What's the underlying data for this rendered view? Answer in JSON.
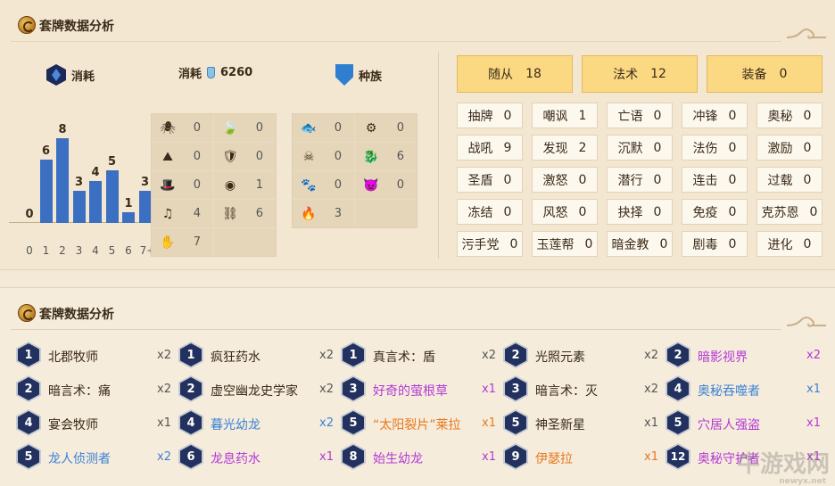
{
  "section1": {
    "title": "套牌数据分析"
  },
  "section2": {
    "title": "套牌数据分析"
  },
  "curve_header": {
    "label": "消耗"
  },
  "total_cost": {
    "label": "消耗",
    "value": "6260"
  },
  "race_header": {
    "label": "种族"
  },
  "chart_data": {
    "type": "bar",
    "title": "",
    "categories": [
      "0",
      "1",
      "2",
      "3",
      "4",
      "5",
      "6",
      "7+"
    ],
    "values": [
      0,
      6,
      8,
      3,
      4,
      5,
      1,
      3
    ],
    "xlabel": "",
    "ylabel": "",
    "ylim": [
      0,
      8
    ],
    "color": "#3b6fc1"
  },
  "class_grid": [
    {
      "icon": "spider-icon",
      "glyph": "🕷",
      "value": "0"
    },
    {
      "icon": "leaf-icon",
      "glyph": "🍃",
      "value": "0"
    },
    {
      "icon": "mountain-icon",
      "glyph": "⛰",
      "value": "0"
    },
    {
      "icon": "shield-icon",
      "glyph": "🛡",
      "value": "0"
    },
    {
      "icon": "hat-icon",
      "glyph": "🎩",
      "value": "0"
    },
    {
      "icon": "eye-icon",
      "glyph": "◉",
      "value": "1"
    },
    {
      "icon": "music-note-icon",
      "glyph": "♫",
      "value": "4"
    },
    {
      "icon": "chain-icon",
      "glyph": "⛓",
      "value": "6"
    },
    {
      "icon": "claw-icon",
      "glyph": "✋",
      "value": "7"
    },
    {
      "icon": "empty",
      "glyph": "",
      "value": ""
    }
  ],
  "race_grid": [
    {
      "icon": "murloc-icon",
      "glyph": "🐟",
      "value": "0"
    },
    {
      "icon": "gear-icon",
      "glyph": "⚙",
      "value": "0"
    },
    {
      "icon": "pirate-icon",
      "glyph": "☠",
      "value": "0"
    },
    {
      "icon": "dragon-icon",
      "glyph": "🐉",
      "value": "6"
    },
    {
      "icon": "paw-icon",
      "glyph": "🐾",
      "value": "0"
    },
    {
      "icon": "demon-icon",
      "glyph": "👿",
      "value": "0"
    },
    {
      "icon": "elemental-icon",
      "glyph": "🔥",
      "value": "3"
    },
    {
      "icon": "empty",
      "glyph": "",
      "value": ""
    }
  ],
  "type_buttons": [
    {
      "label": "随从",
      "value": "18"
    },
    {
      "label": "法术",
      "value": "12"
    },
    {
      "label": "装备",
      "value": "0"
    }
  ],
  "keywords": [
    {
      "label": "抽牌",
      "value": "0"
    },
    {
      "label": "嘲讽",
      "value": "1"
    },
    {
      "label": "亡语",
      "value": "0"
    },
    {
      "label": "冲锋",
      "value": "0"
    },
    {
      "label": "奥秘",
      "value": "0"
    },
    {
      "label": "战吼",
      "value": "9"
    },
    {
      "label": "发现",
      "value": "2"
    },
    {
      "label": "沉默",
      "value": "0"
    },
    {
      "label": "法伤",
      "value": "0"
    },
    {
      "label": "激励",
      "value": "0"
    },
    {
      "label": "圣盾",
      "value": "0"
    },
    {
      "label": "激怒",
      "value": "0"
    },
    {
      "label": "潜行",
      "value": "0"
    },
    {
      "label": "连击",
      "value": "0"
    },
    {
      "label": "过载",
      "value": "0"
    },
    {
      "label": "冻结",
      "value": "0"
    },
    {
      "label": "风怒",
      "value": "0"
    },
    {
      "label": "抉择",
      "value": "0"
    },
    {
      "label": "免疫",
      "value": "0"
    },
    {
      "label": "克苏恩",
      "value": "0"
    },
    {
      "label": "污手党",
      "value": "0"
    },
    {
      "label": "玉莲帮",
      "value": "0"
    },
    {
      "label": "暗金教",
      "value": "0"
    },
    {
      "label": "剧毒",
      "value": "0"
    },
    {
      "label": "进化",
      "value": "0"
    }
  ],
  "rarity_colors": {
    "common": "#3a2a18",
    "rare": "#3b82d6",
    "epic": "#b23ad6",
    "legendary": "#e6791e"
  },
  "cards": [
    {
      "cost": "1",
      "name": "北郡牧师",
      "count": "x2",
      "rarity": "common"
    },
    {
      "cost": "1",
      "name": "疯狂药水",
      "count": "x2",
      "rarity": "common"
    },
    {
      "cost": "1",
      "name": "真言术：盾",
      "count": "x2",
      "rarity": "common"
    },
    {
      "cost": "2",
      "name": "光照元素",
      "count": "x2",
      "rarity": "common"
    },
    {
      "cost": "2",
      "name": "暗影视界",
      "count": "x2",
      "rarity": "epic"
    },
    {
      "cost": "2",
      "name": "暗言术：痛",
      "count": "x2",
      "rarity": "common"
    },
    {
      "cost": "2",
      "name": "虚空幽龙史学家",
      "count": "x2",
      "rarity": "common"
    },
    {
      "cost": "3",
      "name": "好奇的萤根草",
      "count": "x1",
      "rarity": "epic"
    },
    {
      "cost": "3",
      "name": "暗言术：灭",
      "count": "x2",
      "rarity": "common"
    },
    {
      "cost": "4",
      "name": "奥秘吞噬者",
      "count": "x1",
      "rarity": "rare"
    },
    {
      "cost": "4",
      "name": "宴会牧师",
      "count": "x1",
      "rarity": "common"
    },
    {
      "cost": "4",
      "name": "暮光幼龙",
      "count": "x2",
      "rarity": "rare"
    },
    {
      "cost": "5",
      "name": "“太阳裂片”莱拉",
      "count": "x1",
      "rarity": "legendary"
    },
    {
      "cost": "5",
      "name": "神圣新星",
      "count": "x1",
      "rarity": "common"
    },
    {
      "cost": "5",
      "name": "穴居人强盗",
      "count": "x1",
      "rarity": "epic"
    },
    {
      "cost": "5",
      "name": "龙人侦测者",
      "count": "x2",
      "rarity": "rare"
    },
    {
      "cost": "6",
      "name": "龙息药水",
      "count": "x1",
      "rarity": "epic"
    },
    {
      "cost": "8",
      "name": "始生幼龙",
      "count": "x1",
      "rarity": "epic"
    },
    {
      "cost": "9",
      "name": "伊瑟拉",
      "count": "x1",
      "rarity": "legendary"
    },
    {
      "cost": "12",
      "name": "奥秘守护者",
      "count": "x1",
      "rarity": "epic"
    }
  ],
  "watermark": {
    "text": "牛游戏网",
    "url": "newyx.net"
  }
}
